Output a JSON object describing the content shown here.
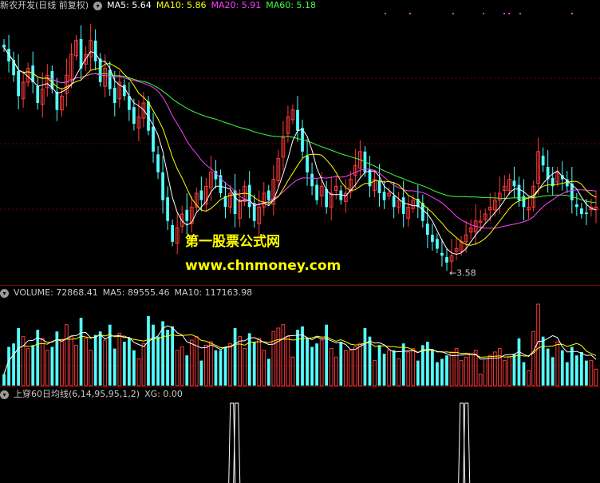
{
  "main_header": {
    "title": "新农开发(日线 前复权)",
    "ma5": "MA5: 5.64",
    "ma10": "MA10: 5.86",
    "ma20": "MA20: 5.91",
    "ma60": "MA60: 5.18"
  },
  "volume_header": {
    "title": "VOLUME: 72868.41",
    "ma5": "MA5: 89555.46",
    "ma10": "MA10: 117163.98"
  },
  "indicator_header": {
    "title": "上穿60日均线(6,14,95,95,1,2)",
    "xg": "XG: 0.00"
  },
  "low_annotation": "3.58",
  "watermark": {
    "line1": "第一股票公式网",
    "line2": "www.chnmoney.com"
  },
  "colors": {
    "up": "#ff3a3a",
    "down": "#54ffff",
    "ma5": "#ffffff",
    "ma10": "#ffff00",
    "ma20": "#ff40ff",
    "ma60": "#40ff40",
    "separator": "#7a0000",
    "watermark": "#ffff00"
  },
  "chart_data": {
    "type": "candlestick",
    "price_range": [
      3.4,
      7.3
    ],
    "low_marker": 3.58,
    "close": [
      6.8,
      6.6,
      6.4,
      6.1,
      6.3,
      6.5,
      6.3,
      6.0,
      6.2,
      6.4,
      6.2,
      5.9,
      6.1,
      6.4,
      6.7,
      6.9,
      6.5,
      6.7,
      6.9,
      6.6,
      6.3,
      6.5,
      6.2,
      6.0,
      6.3,
      6.1,
      5.9,
      5.7,
      5.8,
      6.0,
      5.6,
      5.3,
      5.0,
      4.6,
      4.3,
      4.0,
      4.2,
      4.4,
      4.3,
      4.5,
      4.7,
      4.6,
      4.8,
      5.0,
      4.9,
      4.7,
      4.5,
      4.7,
      4.4,
      4.6,
      4.8,
      4.5,
      4.3,
      4.5,
      4.7,
      4.6,
      4.9,
      5.2,
      5.5,
      5.8,
      5.9,
      5.6,
      5.3,
      5.0,
      4.8,
      4.6,
      4.8,
      4.5,
      4.7,
      4.8,
      4.6,
      4.7,
      4.9,
      5.1,
      5.3,
      5.0,
      4.8,
      4.9,
      4.7,
      4.6,
      4.7,
      4.5,
      4.6,
      4.4,
      4.5,
      4.6,
      4.5,
      4.3,
      4.1,
      4.0,
      3.9,
      3.8,
      3.7,
      3.8,
      3.9,
      4.0,
      4.1,
      4.2,
      4.3,
      4.3,
      4.4,
      4.5,
      4.6,
      4.7,
      4.8,
      4.9,
      4.8,
      4.6,
      4.5,
      4.5,
      4.8,
      5.3,
      5.1,
      4.9,
      4.8,
      5.0,
      4.9,
      4.8,
      4.6,
      4.5,
      4.4,
      4.4,
      4.5,
      4.5
    ],
    "volume_range": [
      0,
      300000
    ],
    "volume_ma5_last": 89555.46,
    "volume_ma10_last": 117163.98,
    "indicator_spikes": [
      0.39,
      0.775
    ]
  }
}
